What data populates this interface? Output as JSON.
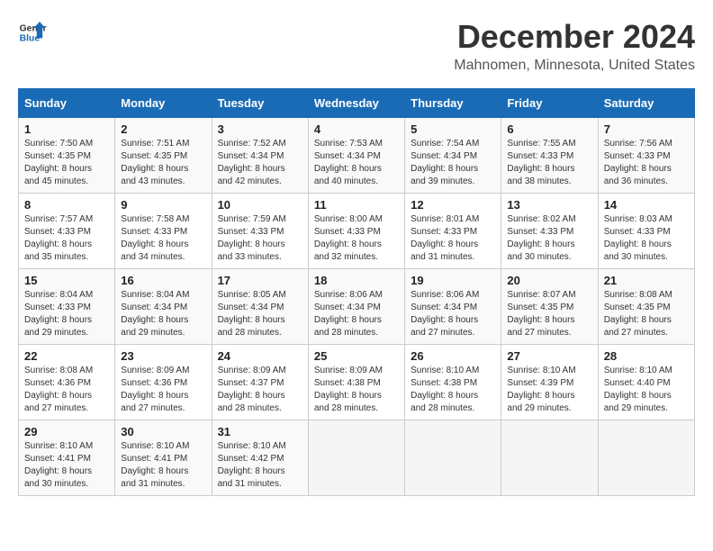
{
  "header": {
    "logo_line1": "General",
    "logo_line2": "Blue",
    "title": "December 2024",
    "subtitle": "Mahnomen, Minnesota, United States"
  },
  "columns": [
    "Sunday",
    "Monday",
    "Tuesday",
    "Wednesday",
    "Thursday",
    "Friday",
    "Saturday"
  ],
  "weeks": [
    [
      {
        "day": "1",
        "info": "Sunrise: 7:50 AM\nSunset: 4:35 PM\nDaylight: 8 hours and 45 minutes."
      },
      {
        "day": "2",
        "info": "Sunrise: 7:51 AM\nSunset: 4:35 PM\nDaylight: 8 hours and 43 minutes."
      },
      {
        "day": "3",
        "info": "Sunrise: 7:52 AM\nSunset: 4:34 PM\nDaylight: 8 hours and 42 minutes."
      },
      {
        "day": "4",
        "info": "Sunrise: 7:53 AM\nSunset: 4:34 PM\nDaylight: 8 hours and 40 minutes."
      },
      {
        "day": "5",
        "info": "Sunrise: 7:54 AM\nSunset: 4:34 PM\nDaylight: 8 hours and 39 minutes."
      },
      {
        "day": "6",
        "info": "Sunrise: 7:55 AM\nSunset: 4:33 PM\nDaylight: 8 hours and 38 minutes."
      },
      {
        "day": "7",
        "info": "Sunrise: 7:56 AM\nSunset: 4:33 PM\nDaylight: 8 hours and 36 minutes."
      }
    ],
    [
      {
        "day": "8",
        "info": "Sunrise: 7:57 AM\nSunset: 4:33 PM\nDaylight: 8 hours and 35 minutes."
      },
      {
        "day": "9",
        "info": "Sunrise: 7:58 AM\nSunset: 4:33 PM\nDaylight: 8 hours and 34 minutes."
      },
      {
        "day": "10",
        "info": "Sunrise: 7:59 AM\nSunset: 4:33 PM\nDaylight: 8 hours and 33 minutes."
      },
      {
        "day": "11",
        "info": "Sunrise: 8:00 AM\nSunset: 4:33 PM\nDaylight: 8 hours and 32 minutes."
      },
      {
        "day": "12",
        "info": "Sunrise: 8:01 AM\nSunset: 4:33 PM\nDaylight: 8 hours and 31 minutes."
      },
      {
        "day": "13",
        "info": "Sunrise: 8:02 AM\nSunset: 4:33 PM\nDaylight: 8 hours and 30 minutes."
      },
      {
        "day": "14",
        "info": "Sunrise: 8:03 AM\nSunset: 4:33 PM\nDaylight: 8 hours and 30 minutes."
      }
    ],
    [
      {
        "day": "15",
        "info": "Sunrise: 8:04 AM\nSunset: 4:33 PM\nDaylight: 8 hours and 29 minutes."
      },
      {
        "day": "16",
        "info": "Sunrise: 8:04 AM\nSunset: 4:34 PM\nDaylight: 8 hours and 29 minutes."
      },
      {
        "day": "17",
        "info": "Sunrise: 8:05 AM\nSunset: 4:34 PM\nDaylight: 8 hours and 28 minutes."
      },
      {
        "day": "18",
        "info": "Sunrise: 8:06 AM\nSunset: 4:34 PM\nDaylight: 8 hours and 28 minutes."
      },
      {
        "day": "19",
        "info": "Sunrise: 8:06 AM\nSunset: 4:34 PM\nDaylight: 8 hours and 27 minutes."
      },
      {
        "day": "20",
        "info": "Sunrise: 8:07 AM\nSunset: 4:35 PM\nDaylight: 8 hours and 27 minutes."
      },
      {
        "day": "21",
        "info": "Sunrise: 8:08 AM\nSunset: 4:35 PM\nDaylight: 8 hours and 27 minutes."
      }
    ],
    [
      {
        "day": "22",
        "info": "Sunrise: 8:08 AM\nSunset: 4:36 PM\nDaylight: 8 hours and 27 minutes."
      },
      {
        "day": "23",
        "info": "Sunrise: 8:09 AM\nSunset: 4:36 PM\nDaylight: 8 hours and 27 minutes."
      },
      {
        "day": "24",
        "info": "Sunrise: 8:09 AM\nSunset: 4:37 PM\nDaylight: 8 hours and 28 minutes."
      },
      {
        "day": "25",
        "info": "Sunrise: 8:09 AM\nSunset: 4:38 PM\nDaylight: 8 hours and 28 minutes."
      },
      {
        "day": "26",
        "info": "Sunrise: 8:10 AM\nSunset: 4:38 PM\nDaylight: 8 hours and 28 minutes."
      },
      {
        "day": "27",
        "info": "Sunrise: 8:10 AM\nSunset: 4:39 PM\nDaylight: 8 hours and 29 minutes."
      },
      {
        "day": "28",
        "info": "Sunrise: 8:10 AM\nSunset: 4:40 PM\nDaylight: 8 hours and 29 minutes."
      }
    ],
    [
      {
        "day": "29",
        "info": "Sunrise: 8:10 AM\nSunset: 4:41 PM\nDaylight: 8 hours and 30 minutes."
      },
      {
        "day": "30",
        "info": "Sunrise: 8:10 AM\nSunset: 4:41 PM\nDaylight: 8 hours and 31 minutes."
      },
      {
        "day": "31",
        "info": "Sunrise: 8:10 AM\nSunset: 4:42 PM\nDaylight: 8 hours and 31 minutes."
      },
      {
        "day": "",
        "info": ""
      },
      {
        "day": "",
        "info": ""
      },
      {
        "day": "",
        "info": ""
      },
      {
        "day": "",
        "info": ""
      }
    ]
  ]
}
